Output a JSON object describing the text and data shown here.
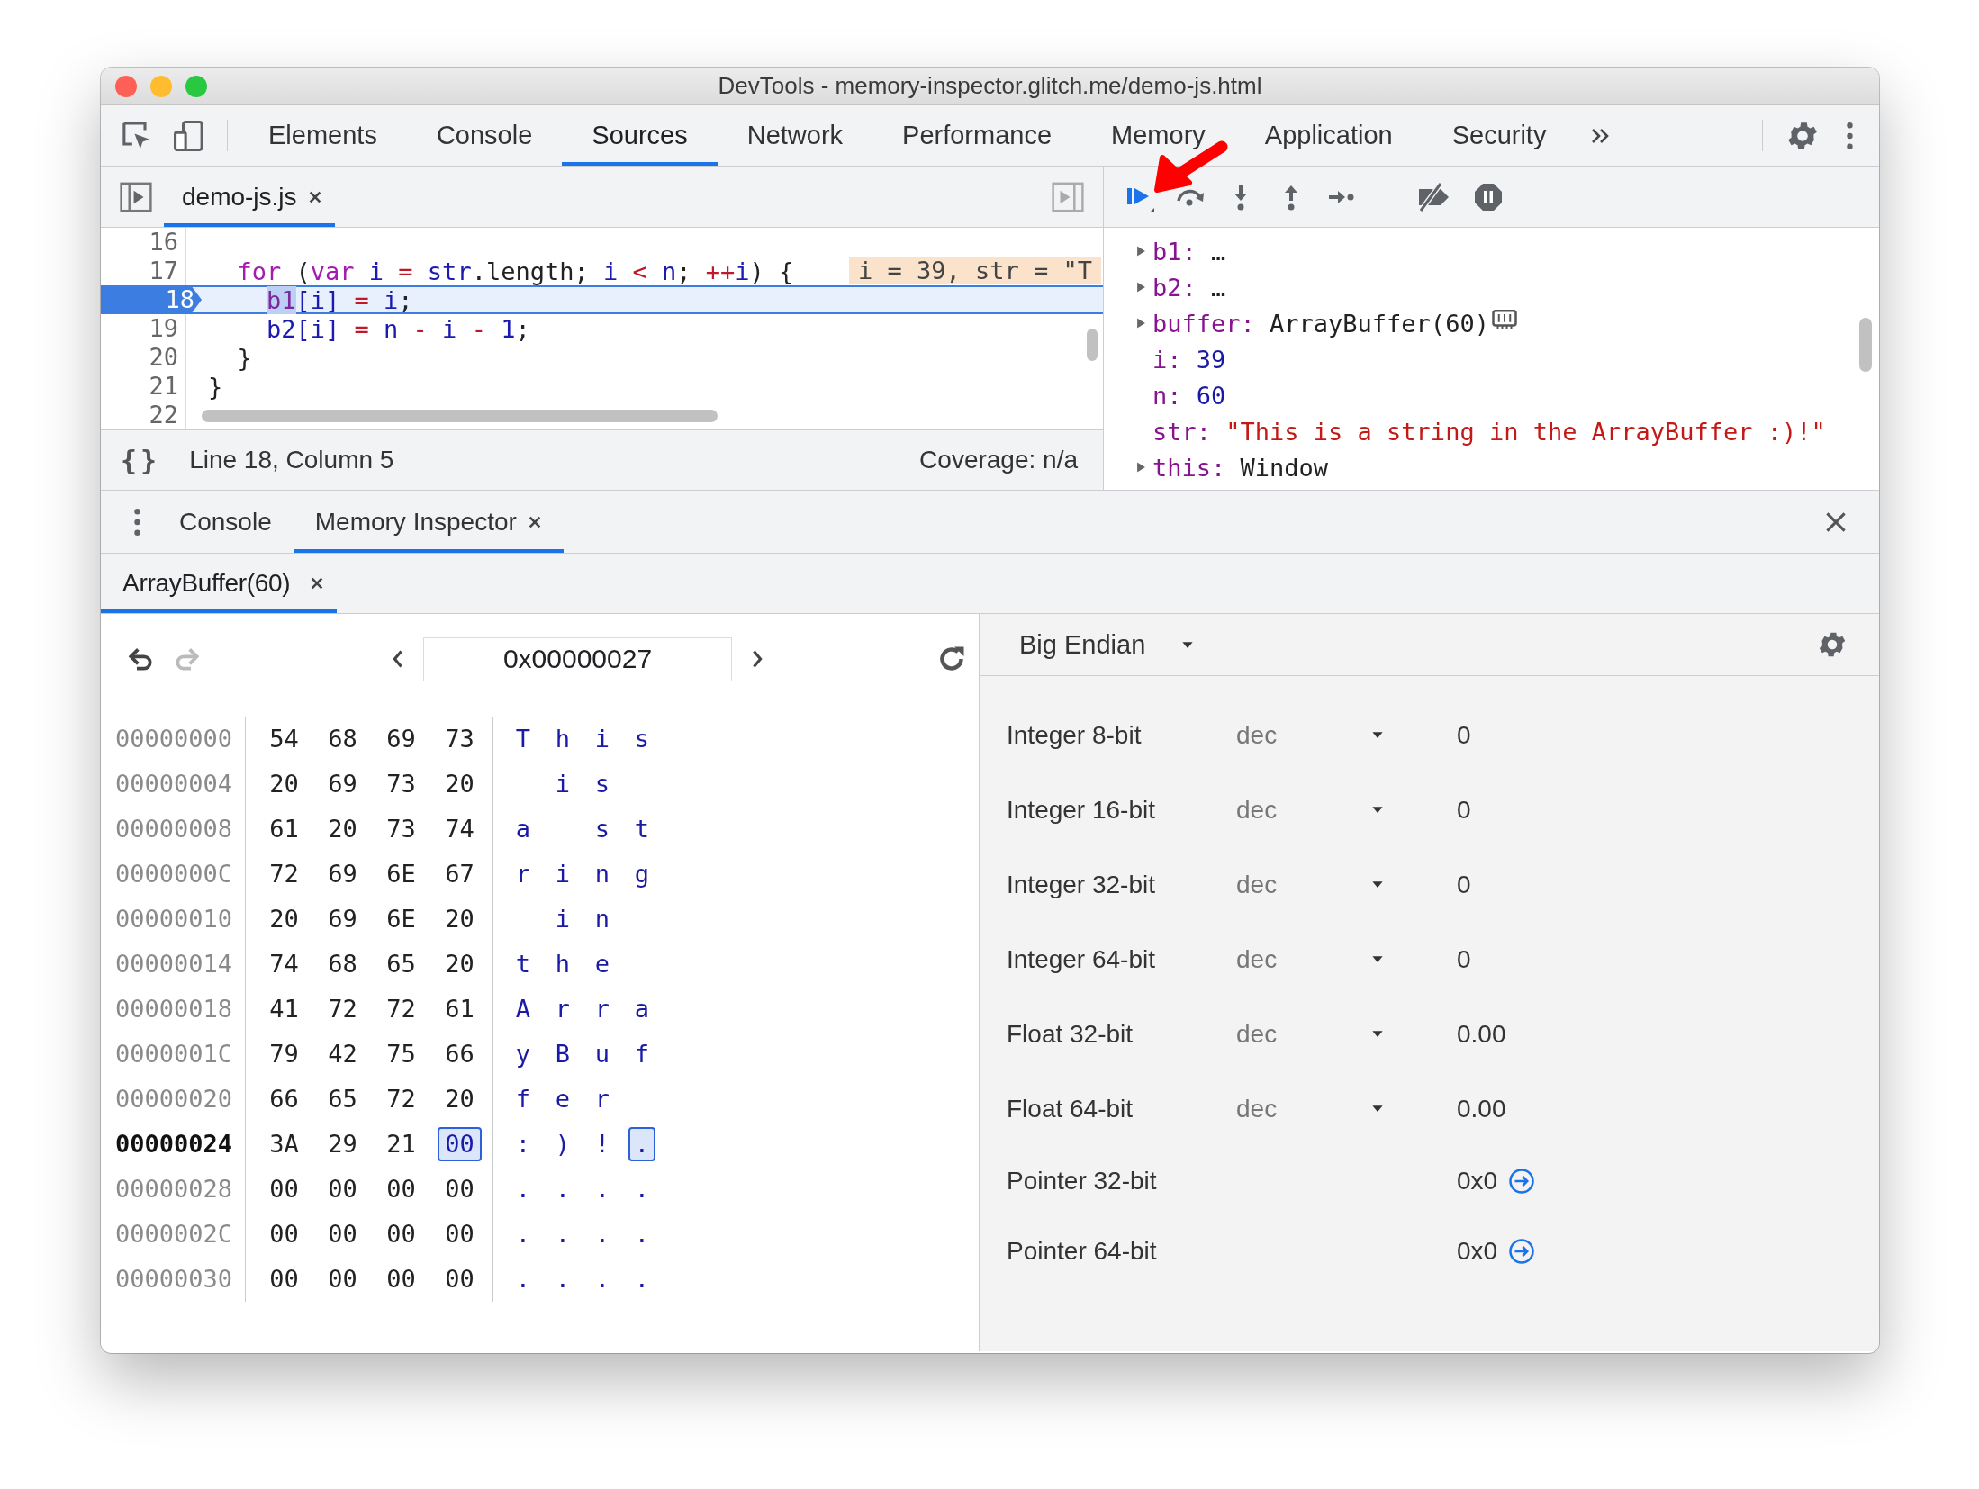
{
  "window": {
    "title": "DevTools - memory-inspector.glitch.me/demo-js.html"
  },
  "main_tabs": [
    {
      "label": "Elements",
      "selected": false
    },
    {
      "label": "Console",
      "selected": false
    },
    {
      "label": "Sources",
      "selected": true
    },
    {
      "label": "Network",
      "selected": false
    },
    {
      "label": "Performance",
      "selected": false
    },
    {
      "label": "Memory",
      "selected": false
    },
    {
      "label": "Application",
      "selected": false
    },
    {
      "label": "Security",
      "selected": false
    }
  ],
  "sources": {
    "file_tabs": [
      {
        "label": "demo-js.js",
        "selected": true
      }
    ],
    "code_lines": [
      {
        "number": "16",
        "current": false
      },
      {
        "number": "17",
        "current": false,
        "tokens": [
          {
            "text": "  for",
            "kind": "keyword"
          },
          {
            "text": " (",
            "kind": "plain"
          },
          {
            "text": "var",
            "kind": "keyword"
          },
          {
            "text": " i",
            "kind": "variable"
          },
          {
            "text": " =",
            "kind": "operator"
          },
          {
            "text": " str",
            "kind": "variable"
          },
          {
            "text": ".length; ",
            "kind": "plain"
          },
          {
            "text": "i",
            "kind": "variable"
          },
          {
            "text": " <",
            "kind": "operator"
          },
          {
            "text": " n",
            "kind": "variable"
          },
          {
            "text": "; ",
            "kind": "plain"
          },
          {
            "text": "++",
            "kind": "operator"
          },
          {
            "text": "i",
            "kind": "variable"
          },
          {
            "text": ") {",
            "kind": "plain"
          }
        ],
        "inline_value": "i = 39, str = \"T"
      },
      {
        "number": "18",
        "current": true,
        "tokens": [
          {
            "text": "    b1",
            "kind": "highlight"
          },
          {
            "text": "[i]",
            "kind": "variable"
          },
          {
            "text": " =",
            "kind": "operator"
          },
          {
            "text": " i",
            "kind": "variable"
          },
          {
            "text": ";",
            "kind": "plain"
          }
        ]
      },
      {
        "number": "19",
        "current": false,
        "tokens": [
          {
            "text": "    b2[i]",
            "kind": "variable"
          },
          {
            "text": " =",
            "kind": "operator"
          },
          {
            "text": " n",
            "kind": "variable"
          },
          {
            "text": " -",
            "kind": "operator"
          },
          {
            "text": " i",
            "kind": "variable"
          },
          {
            "text": " -",
            "kind": "operator"
          },
          {
            "text": " 1",
            "kind": "number"
          },
          {
            "text": ";",
            "kind": "plain"
          }
        ]
      },
      {
        "number": "20",
        "current": false,
        "tokens": [
          {
            "text": "  }",
            "kind": "plain"
          }
        ]
      },
      {
        "number": "21",
        "current": false,
        "tokens": [
          {
            "text": "}",
            "kind": "plain"
          }
        ]
      },
      {
        "number": "22",
        "current": false
      }
    ],
    "status": {
      "format_button": "{}",
      "position": "Line 18, Column 5",
      "coverage": "Coverage: n/a"
    }
  },
  "scope": [
    {
      "name": "b1:",
      "value": "…",
      "kind": "plain",
      "expandable": true,
      "memory_icon": false
    },
    {
      "name": "b2:",
      "value": "…",
      "kind": "plain",
      "expandable": true,
      "memory_icon": false
    },
    {
      "name": "buffer:",
      "value": "ArrayBuffer(60)",
      "kind": "plain",
      "expandable": true,
      "memory_icon": true
    },
    {
      "name": "i:",
      "value": "39",
      "kind": "number",
      "expandable": false,
      "memory_icon": false
    },
    {
      "name": "n:",
      "value": "60",
      "kind": "number",
      "expandable": false,
      "memory_icon": false
    },
    {
      "name": "str:",
      "value": "\"This is a string in the ArrayBuffer :)!\"",
      "kind": "string",
      "expandable": false,
      "memory_icon": false
    },
    {
      "name": "this:",
      "value": "Window",
      "kind": "plain",
      "expandable": true,
      "memory_icon": false
    }
  ],
  "drawer": {
    "tabs": [
      {
        "label": "Console",
        "selected": false,
        "closable": false
      },
      {
        "label": "Memory Inspector",
        "selected": true,
        "closable": true
      }
    ]
  },
  "memory_inspector": {
    "buffer_tabs": [
      {
        "label": "ArrayBuffer(60)",
        "selected": true
      }
    ],
    "history": [
      {
        "kind": "undo",
        "disabled": false
      },
      {
        "kind": "redo",
        "disabled": true
      }
    ],
    "address": "0x00000027",
    "rows": [
      {
        "address": "00000000",
        "current": false,
        "bytes": [
          {
            "hex": "54",
            "char": "T",
            "selected": false
          },
          {
            "hex": "68",
            "char": "h",
            "selected": false
          },
          {
            "hex": "69",
            "char": "i",
            "selected": false
          },
          {
            "hex": "73",
            "char": "s",
            "selected": false
          }
        ]
      },
      {
        "address": "00000004",
        "current": false,
        "bytes": [
          {
            "hex": "20",
            "selected": false
          },
          {
            "hex": "69",
            "char": "i",
            "selected": false
          },
          {
            "hex": "73",
            "char": "s",
            "selected": false
          },
          {
            "hex": "20",
            "selected": false
          }
        ]
      },
      {
        "address": "00000008",
        "current": false,
        "bytes": [
          {
            "hex": "61",
            "char": "a",
            "selected": false
          },
          {
            "hex": "20",
            "selected": false
          },
          {
            "hex": "73",
            "char": "s",
            "selected": false
          },
          {
            "hex": "74",
            "char": "t",
            "selected": false
          }
        ]
      },
      {
        "address": "0000000C",
        "current": false,
        "bytes": [
          {
            "hex": "72",
            "char": "r",
            "selected": false
          },
          {
            "hex": "69",
            "char": "i",
            "selected": false
          },
          {
            "hex": "6E",
            "char": "n",
            "selected": false
          },
          {
            "hex": "67",
            "char": "g",
            "selected": false
          }
        ]
      },
      {
        "address": "00000010",
        "current": false,
        "bytes": [
          {
            "hex": "20",
            "selected": false
          },
          {
            "hex": "69",
            "char": "i",
            "selected": false
          },
          {
            "hex": "6E",
            "char": "n",
            "selected": false
          },
          {
            "hex": "20",
            "selected": false
          }
        ]
      },
      {
        "address": "00000014",
        "current": false,
        "bytes": [
          {
            "hex": "74",
            "char": "t",
            "selected": false
          },
          {
            "hex": "68",
            "char": "h",
            "selected": false
          },
          {
            "hex": "65",
            "char": "e",
            "selected": false
          },
          {
            "hex": "20",
            "selected": false
          }
        ]
      },
      {
        "address": "00000018",
        "current": false,
        "bytes": [
          {
            "hex": "41",
            "char": "A",
            "selected": false
          },
          {
            "hex": "72",
            "char": "r",
            "selected": false
          },
          {
            "hex": "72",
            "char": "r",
            "selected": false
          },
          {
            "hex": "61",
            "char": "a",
            "selected": false
          }
        ]
      },
      {
        "address": "0000001C",
        "current": false,
        "bytes": [
          {
            "hex": "79",
            "char": "y",
            "selected": false
          },
          {
            "hex": "42",
            "char": "B",
            "selected": false
          },
          {
            "hex": "75",
            "char": "u",
            "selected": false
          },
          {
            "hex": "66",
            "char": "f",
            "selected": false
          }
        ]
      },
      {
        "address": "00000020",
        "current": false,
        "bytes": [
          {
            "hex": "66",
            "char": "f",
            "selected": false
          },
          {
            "hex": "65",
            "char": "e",
            "selected": false
          },
          {
            "hex": "72",
            "char": "r",
            "selected": false
          },
          {
            "hex": "20",
            "selected": false
          }
        ]
      },
      {
        "address": "00000024",
        "current": true,
        "bytes": [
          {
            "hex": "3A",
            "char": ":",
            "selected": false
          },
          {
            "hex": "29",
            "char": ")",
            "selected": false
          },
          {
            "hex": "21",
            "char": "!",
            "selected": false
          },
          {
            "hex": "00",
            "char": ".",
            "selected": true
          }
        ]
      },
      {
        "address": "00000028",
        "current": false,
        "bytes": [
          {
            "hex": "00",
            "char": ".",
            "selected": false
          },
          {
            "hex": "00",
            "char": ".",
            "selected": false
          },
          {
            "hex": "00",
            "char": ".",
            "selected": false
          },
          {
            "hex": "00",
            "char": ".",
            "selected": false
          }
        ]
      },
      {
        "address": "0000002C",
        "current": false,
        "bytes": [
          {
            "hex": "00",
            "char": ".",
            "selected": false
          },
          {
            "hex": "00",
            "char": ".",
            "selected": false
          },
          {
            "hex": "00",
            "char": ".",
            "selected": false
          },
          {
            "hex": "00",
            "char": ".",
            "selected": false
          }
        ]
      },
      {
        "address": "00000030",
        "current": false,
        "bytes": [
          {
            "hex": "00",
            "char": ".",
            "selected": false
          },
          {
            "hex": "00",
            "char": ".",
            "selected": false
          },
          {
            "hex": "00",
            "char": ".",
            "selected": false
          },
          {
            "hex": "00",
            "char": ".",
            "selected": false
          }
        ]
      }
    ],
    "endianness": "Big Endian",
    "values": [
      {
        "kind": "number",
        "label": "Integer 8-bit",
        "format": "dec",
        "value": "0"
      },
      {
        "kind": "number",
        "label": "Integer 16-bit",
        "format": "dec",
        "value": "0"
      },
      {
        "kind": "number",
        "label": "Integer 32-bit",
        "format": "dec",
        "value": "0"
      },
      {
        "kind": "number",
        "label": "Integer 64-bit",
        "format": "dec",
        "value": "0"
      },
      {
        "kind": "number",
        "label": "Float 32-bit",
        "format": "dec",
        "value": "0.00"
      },
      {
        "kind": "number",
        "label": "Float 64-bit",
        "format": "dec",
        "value": "0.00"
      },
      {
        "kind": "pointer",
        "label": "Pointer 32-bit",
        "value": "0x0"
      },
      {
        "kind": "pointer",
        "label": "Pointer 64-bit",
        "value": "0x0"
      }
    ]
  }
}
